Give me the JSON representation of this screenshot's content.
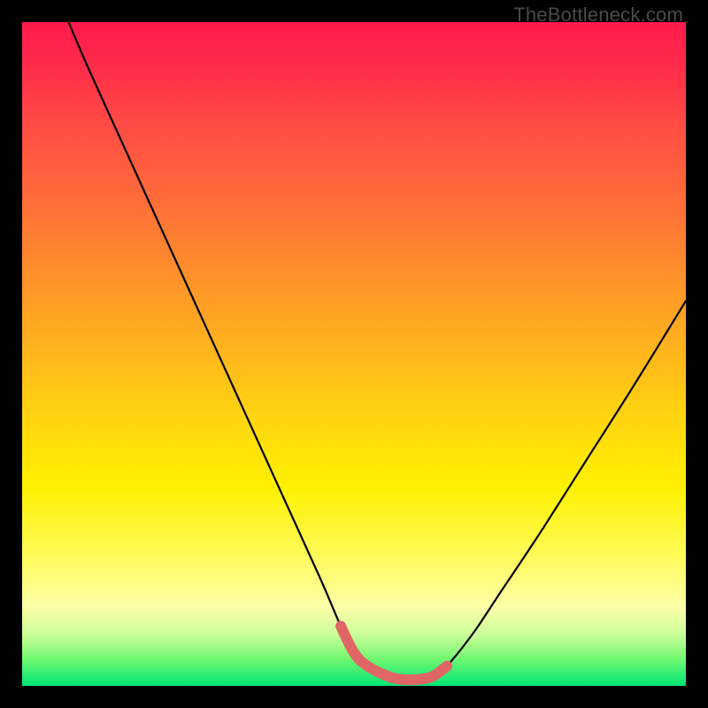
{
  "watermark": "TheBottleneck.com",
  "colors": {
    "curve": "#000000",
    "flat_highlight": "#e06666",
    "background": "#000000"
  },
  "chart_data": {
    "type": "line",
    "title": "",
    "xlabel": "",
    "ylabel": "",
    "xlim": [
      0,
      100
    ],
    "ylim": [
      0,
      100
    ],
    "annotations": [],
    "series": [
      {
        "name": "bottleneck-curve",
        "x": [
          7,
          10,
          15,
          20,
          25,
          30,
          35,
          40,
          45,
          48,
          50,
          52,
          55,
          57,
          60,
          62,
          64,
          68,
          72,
          78,
          85,
          92,
          100
        ],
        "y": [
          100,
          93,
          82,
          71,
          60,
          49,
          38,
          27,
          16,
          9,
          5,
          3,
          1.5,
          1,
          1,
          1.5,
          3,
          8,
          14,
          23,
          34,
          45,
          58
        ]
      },
      {
        "name": "flat-region-highlight",
        "x": [
          48,
          50,
          52,
          55,
          57,
          60,
          62,
          64
        ],
        "y": [
          9,
          5,
          3,
          1.5,
          1,
          1,
          1.5,
          3
        ]
      }
    ]
  }
}
